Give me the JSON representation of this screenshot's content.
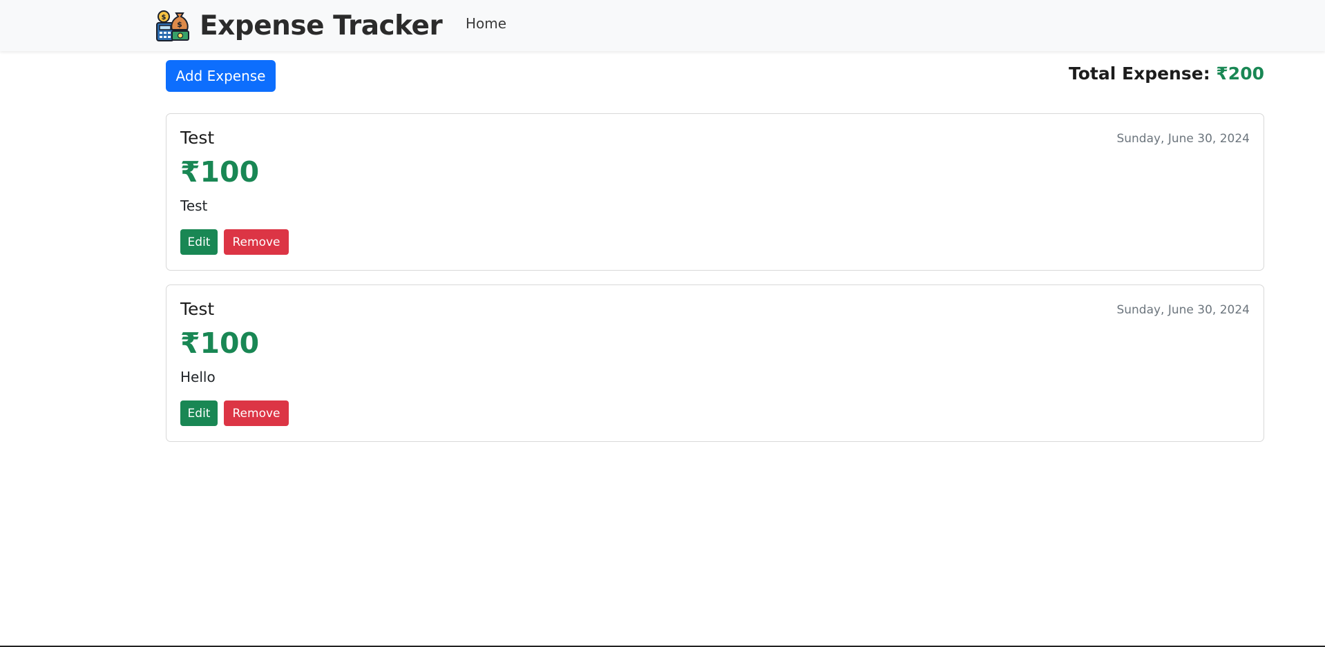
{
  "navbar": {
    "brand": "Expense Tracker",
    "logo_icon": "money-bag-calculator-icon",
    "home_link": "Home"
  },
  "toolbar": {
    "add_label": "Add Expense",
    "total_label": "Total Expense:",
    "total_value": "₹200"
  },
  "expenses": [
    {
      "title": "Test",
      "date": "Sunday, June 30, 2024",
      "amount": "₹100",
      "description": "Test",
      "edit_label": "Edit",
      "remove_label": "Remove"
    },
    {
      "title": "Test",
      "date": "Sunday, June 30, 2024",
      "amount": "₹100",
      "description": "Hello",
      "edit_label": "Edit",
      "remove_label": "Remove"
    }
  ],
  "colors": {
    "primary": "#0d6efd",
    "success": "#198754",
    "danger": "#dc3545",
    "navbar_bg": "#f8f9fa"
  }
}
